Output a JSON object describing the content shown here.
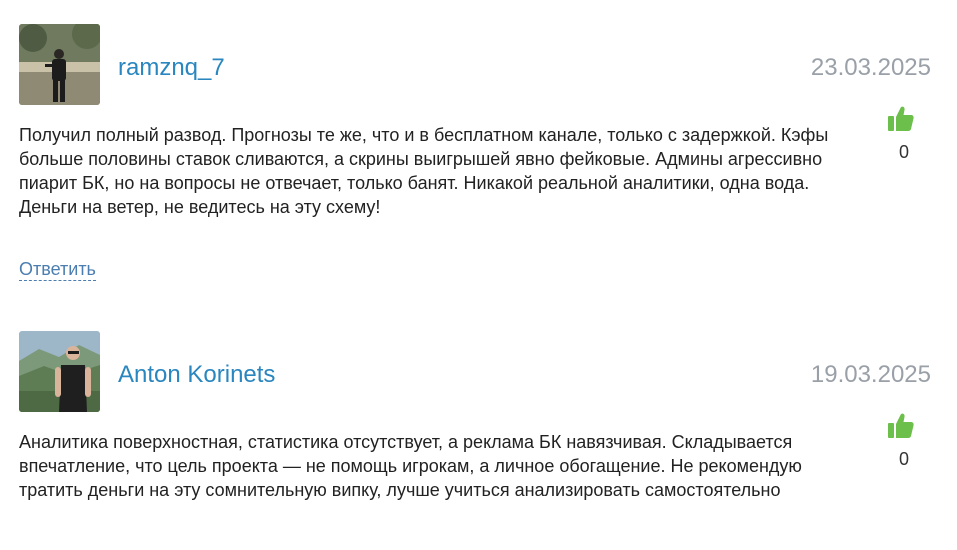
{
  "comments": [
    {
      "username": "ramznq_7",
      "date": "23.03.2025",
      "likes": "0",
      "text": "Получил полный развод. Прогнозы те же, что и в бесплатном канале, только с задержкой. Кэфы больше половины ставок сливаются, а скрины выигрышей явно фейковые. Админы агрессивно пиарит БК, но на вопросы не отвечает, только банят. Никакой реальной аналитики, одна вода. Деньги на ветер, не ведитесь на эту схему!",
      "reply_label": "Ответить",
      "icons": {
        "avatar": "user-avatar-photo",
        "like": "thumbs-up-icon"
      }
    },
    {
      "username": "Anton Korinets",
      "date": "19.03.2025",
      "likes": "0",
      "text": "Аналитика поверхностная, статистика отсутствует, а реклама БК навязчивая. Складывается впечатление, что цель проекта — не помощь игрокам, а личное обогащение. Не рекомендую тратить деньги на эту сомнительную випку, лучше учиться анализировать самостоятельно",
      "icons": {
        "avatar": "user-avatar-photo",
        "like": "thumbs-up-icon"
      }
    }
  ],
  "colors": {
    "username": "#2a86bf",
    "date": "#9aa0a8",
    "like": "#6cbf4b",
    "reply": "#4b7db0"
  }
}
